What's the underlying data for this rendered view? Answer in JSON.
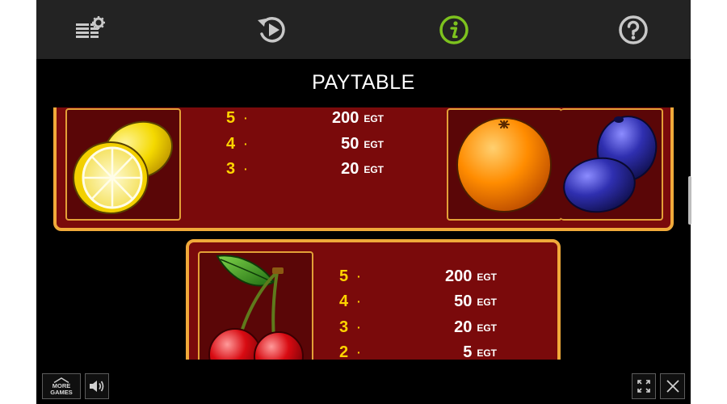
{
  "toolbar": {
    "items": [
      {
        "icon": "settings-icon"
      },
      {
        "icon": "history-icon"
      },
      {
        "icon": "info-icon",
        "active": true,
        "color": "#7dc21e"
      },
      {
        "icon": "help-icon"
      }
    ]
  },
  "title": "PAYTABLE",
  "paytables": [
    {
      "symbols": [
        "lemon",
        "orange",
        "plum"
      ],
      "rows": [
        {
          "count": "5",
          "value": "200",
          "unit": "EGT"
        },
        {
          "count": "4",
          "value": "50",
          "unit": "EGT"
        },
        {
          "count": "3",
          "value": "20",
          "unit": "EGT"
        }
      ]
    },
    {
      "symbols": [
        "cherry"
      ],
      "rows": [
        {
          "count": "5",
          "value": "200",
          "unit": "EGT"
        },
        {
          "count": "4",
          "value": "50",
          "unit": "EGT"
        },
        {
          "count": "3",
          "value": "20",
          "unit": "EGT"
        },
        {
          "count": "2",
          "value": "5",
          "unit": "EGT"
        }
      ]
    }
  ],
  "bottom": {
    "more_games_line1": "MORE",
    "more_games_line2": "GAMES"
  },
  "colors": {
    "panel": "#7a0a0b",
    "panel_border": "#f0a93a",
    "count": "#ffd400",
    "value": "#ffffff"
  }
}
